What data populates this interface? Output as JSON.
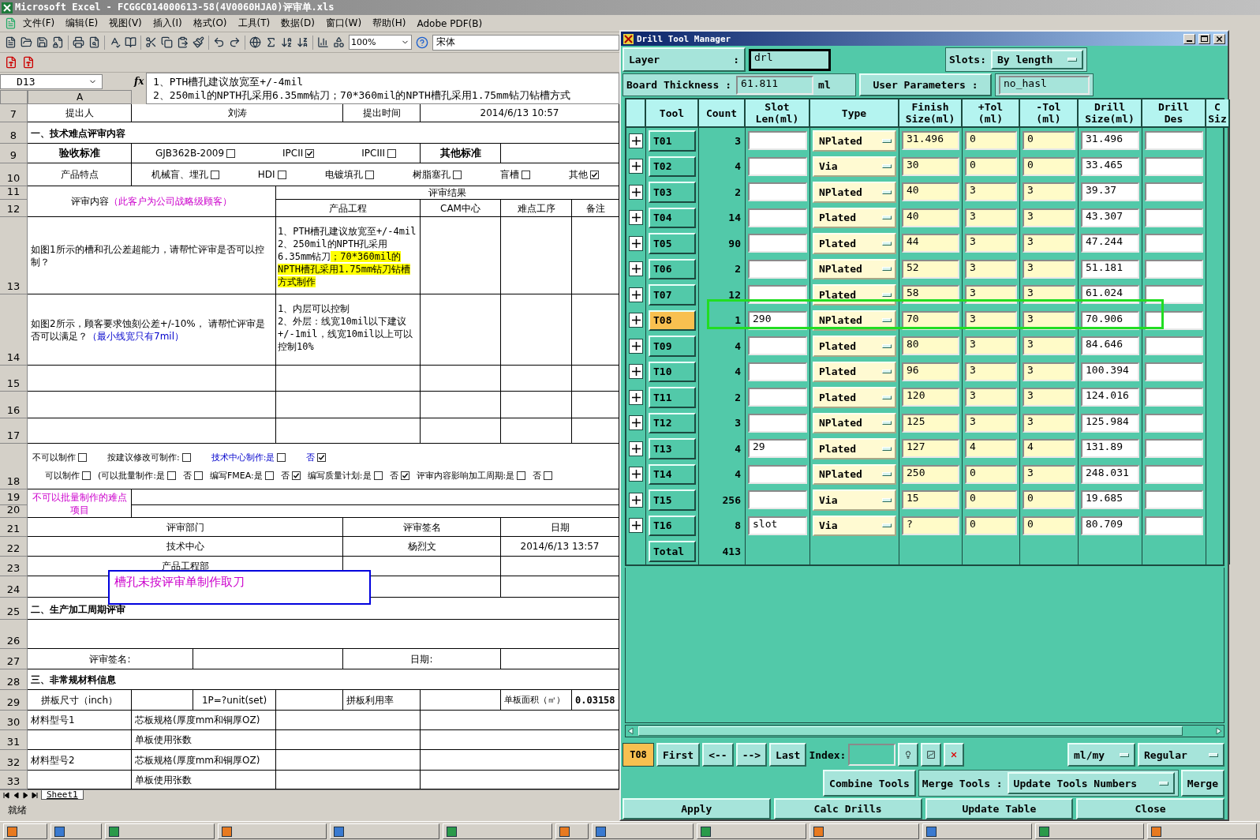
{
  "excel": {
    "title": "Microsoft Excel - FCGGC014000613-58(4V0060HJA0)评审单.xls",
    "menu": [
      "文件(F)",
      "编辑(E)",
      "视图(V)",
      "插入(I)",
      "格式(O)",
      "工具(T)",
      "数据(D)",
      "窗口(W)",
      "帮助(H)",
      "Adobe PDF(B)"
    ],
    "zoom": "100%",
    "font": "宋体",
    "name_box": "D13",
    "formula_label": "fx",
    "formula": [
      "1、PTH槽孔建议放宽至+/-4mil",
      "2、250mil的NPTH孔采用6.35mm钻刀；70*360mil的NPTH槽孔采用1.75mm钻刀钻槽方式"
    ],
    "column_header": "A",
    "rows": [
      {
        "number": "7",
        "cells": [
          {
            "kind": "label",
            "text": "提出人"
          },
          {
            "kind": "label",
            "text": "刘涛"
          },
          "",
          "",
          {
            "kind": "label",
            "text": "提出时间"
          },
          {
            "kind": "label",
            "text": "2014/6/13 10:57"
          },
          "",
          ""
        ]
      },
      {
        "number": "8",
        "cells": [
          {
            "kind": "section",
            "text": "一、技术难点评审内容"
          },
          "",
          "",
          "",
          "",
          "",
          "",
          ""
        ]
      },
      {
        "number": "9",
        "cells": [
          {
            "kind": "strong",
            "text": "验收标准"
          },
          {
            "kind": "checks",
            "items": [
              {
                "label": "GJB362B-2009",
                "checked": false
              },
              {
                "label": "IPCII",
                "checked": true
              },
              {
                "label": "IPCIII",
                "checked": false
              }
            ]
          },
          "",
          "",
          "",
          {
            "kind": "strong",
            "text": "其他标准"
          },
          "",
          ""
        ]
      },
      {
        "number": "10",
        "cells": [
          {
            "kind": "label",
            "text": "产品特点"
          },
          {
            "kind": "checks",
            "items": [
              {
                "label": "机械盲、埋孔",
                "checked": false
              },
              {
                "label": "HDI",
                "checked": false
              },
              {
                "label": "电镀填孔",
                "checked": false
              },
              {
                "label": "树脂塞孔",
                "checked": false
              },
              {
                "label": "盲槽",
                "checked": false
              },
              {
                "label": "其他",
                "checked": true
              }
            ]
          },
          "",
          "",
          "",
          "",
          "",
          ""
        ]
      },
      {
        "number": "11",
        "cells": [
          {
            "kind": "label",
            "parts": [
              {
                "text": "评审内容",
                "kind": "plain"
              },
              {
                "text": "（此客户为公司战略级顾客）",
                "kind": "note"
              }
            ]
          },
          "",
          "",
          "",
          "",
          {
            "kind": "label",
            "text": "评审结果"
          },
          "",
          ""
        ]
      },
      {
        "number": "12",
        "cells": [
          "",
          "",
          "",
          {
            "kind": "label",
            "text": "产品工程"
          },
          "",
          {
            "kind": "label",
            "text": "CAM中心"
          },
          {
            "kind": "label",
            "text": "难点工序"
          },
          {
            "kind": "label",
            "text": "备注"
          }
        ]
      },
      {
        "number": "13",
        "cells": [
          {
            "kind": "para",
            "text": "如图1所示的槽和孔公差超能力，请帮忙评审是否可以控制？"
          },
          "",
          "",
          {
            "kind": "answer",
            "parts": [
              {
                "text": "1、PTH槽孔建议放宽至+/-4mil\n2、250mil的NPTH孔采用6.35mm钻刀",
                "highlight": false
              },
              {
                "text": "；70*360mil的NPTH槽孔采用1.75mm钻刀钻槽方式制作",
                "highlight": true
              }
            ]
          },
          "",
          "",
          "",
          ""
        ]
      },
      {
        "number": "14",
        "cells": [
          {
            "kind": "para",
            "parts": [
              {
                "text": "如图2所示，顾客要求蚀刻公差+/-10%， 请帮忙评审是否可以满足？",
                "kind": "plain"
              },
              {
                "text": "（最小线宽只有7mil）",
                "kind": "hint"
              }
            ]
          },
          "",
          "",
          {
            "kind": "answer",
            "text": "1、内层可以控制\n2、外层：线宽10mil以下建议+/-1mil，线宽10mil以上可以控制10%"
          },
          "",
          "",
          "",
          ""
        ]
      },
      {
        "number": "15",
        "cells": [
          "",
          "",
          "",
          "",
          "",
          "",
          "",
          ""
        ]
      },
      {
        "number": "16",
        "cells": [
          "",
          "",
          "",
          "",
          "",
          "",
          "",
          ""
        ]
      },
      {
        "number": "17",
        "cells": [
          "",
          "",
          "",
          "",
          "",
          "",
          "",
          ""
        ]
      },
      {
        "number": "18",
        "cells": [
          {
            "kind": "check_lines",
            "lines": [
              {
                "items": [
                  {
                    "label": "不可以制作",
                    "checked": false,
                    "kind": "plain"
                  },
                  {
                    "label": "按建议修改可制作:",
                    "checked": false,
                    "kind": "plain"
                  },
                  {
                    "label": "技术中心制作:是",
                    "checked": false,
                    "kind": "hint"
                  },
                  {
                    "label": "否",
                    "checked": true,
                    "kind": "hint"
                  }
                ]
              },
              {
                "items": [
                  {
                    "label": "可以制作",
                    "checked": false,
                    "kind": "plain"
                  },
                  {
                    "label": "(可以批量制作:是",
                    "checked": false,
                    "kind": "plain"
                  },
                  {
                    "label": "否",
                    "checked": false,
                    "kind": "plain"
                  },
                  {
                    "label": "编写FMEA:是",
                    "checked": false,
                    "kind": "plain"
                  },
                  {
                    "label": "否",
                    "checked": true,
                    "kind": "plain"
                  },
                  {
                    "label": "编写质量计划:是",
                    "checked": false,
                    "kind": "plain"
                  },
                  {
                    "label": "否",
                    "checked": true,
                    "kind": "plain"
                  },
                  {
                    "label": "评审内容影响加工周期:是",
                    "checked": false,
                    "kind": "plain"
                  },
                  {
                    "label": "否",
                    "checked": false,
                    "kind": "plain"
                  }
                ]
              }
            ]
          },
          "",
          "",
          "",
          "",
          "",
          "",
          ""
        ]
      },
      {
        "number": "19",
        "cells": [
          {
            "kind": "label",
            "parts": [
              {
                "text": "不可以批量制作的难点项目",
                "kind": "note"
              }
            ]
          },
          "",
          "",
          "",
          "",
          "",
          "",
          ""
        ]
      },
      {
        "number": "20",
        "cells": [
          "",
          "",
          "",
          "",
          "",
          "",
          "",
          ""
        ]
      },
      {
        "number": "21",
        "cells": [
          {
            "kind": "label",
            "text": "评审部门"
          },
          "",
          "",
          "",
          {
            "kind": "label",
            "text": "评审签名"
          },
          "",
          {
            "kind": "label",
            "text": "日期"
          },
          ""
        ]
      },
      {
        "number": "22",
        "cells": [
          {
            "kind": "label",
            "text": "技术中心"
          },
          "",
          "",
          "",
          {
            "kind": "label",
            "text": "杨烈文"
          },
          "",
          {
            "kind": "label",
            "text": "2014/6/13 13:57"
          },
          ""
        ]
      },
      {
        "number": "23",
        "cells": [
          {
            "kind": "label",
            "text": "产品工程部"
          },
          "",
          "",
          "",
          "",
          "",
          "",
          ""
        ]
      },
      {
        "number": "24",
        "cells": [
          "",
          "",
          "",
          "",
          "",
          "",
          "",
          ""
        ]
      },
      {
        "number": "25",
        "cells": [
          {
            "kind": "section",
            "text": "二、生产加工周期评审"
          },
          "",
          "",
          "",
          "",
          "",
          "",
          ""
        ]
      },
      {
        "number": "26",
        "cells": [
          "",
          "",
          "",
          "",
          "",
          "",
          "",
          ""
        ]
      },
      {
        "number": "27",
        "cells": [
          {
            "kind": "label",
            "text": "评审签名:"
          },
          "",
          "",
          "",
          {
            "kind": "label",
            "text": "日期:"
          },
          "",
          "",
          ""
        ]
      },
      {
        "number": "28",
        "cells": [
          {
            "kind": "section",
            "text": "三、非常规材料信息"
          },
          "",
          "",
          "",
          "",
          "",
          "",
          ""
        ]
      },
      {
        "number": "29",
        "cells": [
          {
            "kind": "label",
            "text": "拼板尺寸（inch）"
          },
          "",
          {
            "kind": "label",
            "text": "1P=?unit(set)"
          },
          "",
          {
            "kind": "text",
            "text": "拼板利用率"
          },
          "",
          {
            "kind": "small",
            "text": "单板面积（㎡）"
          },
          {
            "kind": "number",
            "text": "0.03158"
          }
        ]
      },
      {
        "number": "30",
        "cells": [
          {
            "kind": "text",
            "text": "材料型号1"
          },
          {
            "kind": "text",
            "text": "芯板规格(厚度mm和铜厚OZ)"
          },
          "",
          "",
          "",
          "",
          "",
          ""
        ]
      },
      {
        "number": "31",
        "cells": [
          "",
          {
            "kind": "text",
            "text": "单板使用张数"
          },
          "",
          "",
          "",
          "",
          "",
          ""
        ]
      },
      {
        "number": "32",
        "cells": [
          {
            "kind": "text",
            "text": "材料型号2"
          },
          {
            "kind": "text",
            "text": "芯板规格(厚度mm和铜厚OZ)"
          },
          "",
          "",
          "",
          "",
          "",
          ""
        ]
      },
      {
        "number": "33",
        "cells": [
          "",
          {
            "kind": "text",
            "text": "单板使用张数"
          },
          "",
          "",
          "",
          "",
          "",
          ""
        ]
      }
    ],
    "text_box": "槽孔未按评审单制作取刀",
    "sheet_tabs": [
      {
        "label": "Sheet1",
        "selected": true
      }
    ],
    "status": "就绪"
  },
  "drill": {
    "title": "Drill Tool Manager",
    "layer": {
      "label": [
        "Layer",
        ":"
      ],
      "value": "drl"
    },
    "slots": {
      "label": "Slots:",
      "value": "By length"
    },
    "board_thickness": {
      "label": "Board Thickness :",
      "value": "61.811",
      "unit": "ml"
    },
    "user_parameters": {
      "label": "User Parameters :",
      "value": "no_hasl"
    },
    "columns": [
      "Tool",
      "Count",
      "Slot\nLen(ml)",
      "Type",
      "Finish\nSize(ml)",
      "+Tol\n(ml)",
      "-Tol\n(ml)",
      "Drill\nSize(ml)",
      "Drill\nDes",
      "C\nSiz"
    ],
    "tools": [
      {
        "tool": "T01",
        "selected": false,
        "count": "3",
        "type": "NPlated",
        "finish": "31.496",
        "plus_tol": "0",
        "minus_tol": "0",
        "drill_size": "31.496"
      },
      {
        "tool": "T02",
        "selected": false,
        "count": "4",
        "type": "Via",
        "finish": "30",
        "plus_tol": "0",
        "minus_tol": "0",
        "drill_size": "33.465"
      },
      {
        "tool": "T03",
        "selected": false,
        "count": "2",
        "type": "NPlated",
        "finish": "40",
        "plus_tol": "3",
        "minus_tol": "3",
        "drill_size": "39.37"
      },
      {
        "tool": "T04",
        "selected": false,
        "count": "14",
        "type": "Plated",
        "finish": "40",
        "plus_tol": "3",
        "minus_tol": "3",
        "drill_size": "43.307"
      },
      {
        "tool": "T05",
        "selected": false,
        "count": "90",
        "type": "Plated",
        "finish": "44",
        "plus_tol": "3",
        "minus_tol": "3",
        "drill_size": "47.244"
      },
      {
        "tool": "T06",
        "selected": false,
        "count": "2",
        "type": "NPlated",
        "finish": "52",
        "plus_tol": "3",
        "minus_tol": "3",
        "drill_size": "51.181"
      },
      {
        "tool": "T07",
        "selected": false,
        "count": "12",
        "type": "Plated",
        "finish": "58",
        "plus_tol": "3",
        "minus_tol": "3",
        "drill_size": "61.024"
      },
      {
        "tool": "T08",
        "selected": true,
        "count": "1",
        "slot_len": "290",
        "type": "NPlated",
        "finish": "70",
        "plus_tol": "3",
        "minus_tol": "3",
        "drill_size": "70.906"
      },
      {
        "tool": "T09",
        "selected": false,
        "count": "4",
        "type": "Plated",
        "finish": "80",
        "plus_tol": "3",
        "minus_tol": "3",
        "drill_size": "84.646"
      },
      {
        "tool": "T10",
        "selected": false,
        "count": "4",
        "type": "Plated",
        "finish": "96",
        "plus_tol": "3",
        "minus_tol": "3",
        "drill_size": "100.394"
      },
      {
        "tool": "T11",
        "selected": false,
        "count": "2",
        "type": "Plated",
        "finish": "120",
        "plus_tol": "3",
        "minus_tol": "3",
        "drill_size": "124.016"
      },
      {
        "tool": "T12",
        "selected": false,
        "count": "3",
        "type": "NPlated",
        "finish": "125",
        "plus_tol": "3",
        "minus_tol": "3",
        "drill_size": "125.984"
      },
      {
        "tool": "T13",
        "selected": false,
        "count": "4",
        "slot_len": "29",
        "type": "Plated",
        "finish": "127",
        "plus_tol": "4",
        "minus_tol": "4",
        "drill_size": "131.89"
      },
      {
        "tool": "T14",
        "selected": false,
        "count": "4",
        "type": "NPlated",
        "finish": "250",
        "plus_tol": "0",
        "minus_tol": "3",
        "drill_size": "248.031"
      },
      {
        "tool": "T15",
        "selected": false,
        "count": "256",
        "type": "Via",
        "finish": "15",
        "plus_tol": "0",
        "minus_tol": "0",
        "drill_size": "19.685"
      },
      {
        "tool": "T16",
        "selected": false,
        "count": "8",
        "slot_len": "slot",
        "type": "Via",
        "finish": "?",
        "plus_tol": "0",
        "minus_tol": "0",
        "drill_size": "80.709"
      }
    ],
    "total": {
      "label": "Total",
      "count": "413"
    },
    "current_tool": "T08",
    "nav_buttons": [
      "First",
      "<--",
      "-->",
      "Last"
    ],
    "index_label": "Index:",
    "units": "ml/my",
    "mode": "Regular",
    "combine_button": "Combine Tools",
    "merge_label": "Merge Tools :",
    "merge_option": "Update Tools Numbers",
    "merge_button": "Merge",
    "actions": [
      "Apply",
      "Calc Drills",
      "Update Table",
      "Close"
    ]
  }
}
